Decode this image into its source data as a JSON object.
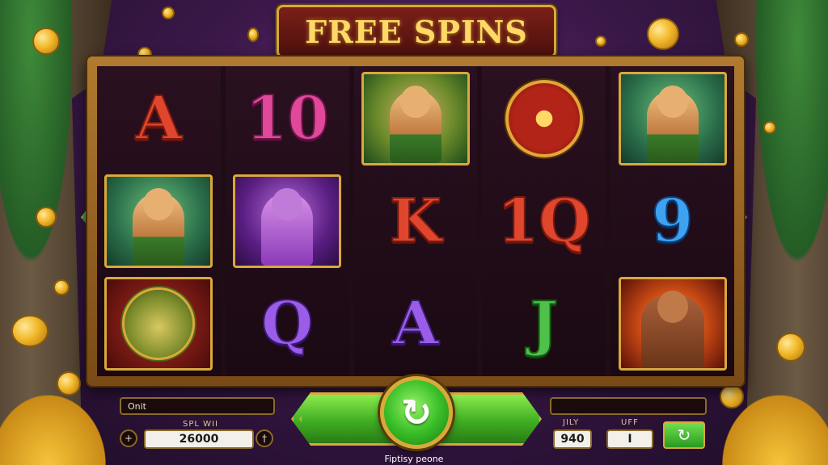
{
  "game": {
    "title": "FREE SPINS"
  },
  "reels": [
    [
      {
        "type": "letter",
        "text": "A",
        "color": "red"
      },
      {
        "type": "card",
        "style": "green",
        "figure": "skin"
      },
      {
        "type": "card",
        "style": "lion",
        "figure": "lion"
      }
    ],
    [
      {
        "type": "letter",
        "text": "10",
        "color": "pink"
      },
      {
        "type": "card",
        "style": "purple",
        "figure": "purple"
      },
      {
        "type": "letter",
        "text": "Q",
        "color": "purple"
      }
    ],
    [
      {
        "type": "card",
        "style": "warriors",
        "figure": "skin"
      },
      {
        "type": "letter",
        "text": "K",
        "color": "red"
      },
      {
        "type": "letter",
        "text": "A",
        "color": "purple"
      }
    ],
    [
      {
        "type": "shield"
      },
      {
        "type": "letter",
        "text": "1Q",
        "color": "red"
      },
      {
        "type": "letter",
        "text": "J",
        "color": "green"
      }
    ],
    [
      {
        "type": "card",
        "style": "green",
        "figure": "skin"
      },
      {
        "type": "letter",
        "text": "9",
        "color": "blue"
      },
      {
        "type": "card",
        "style": "fire",
        "figure": "ape"
      }
    ]
  ],
  "controls": {
    "left_info_text": "Onit",
    "win_label": "SPL WII",
    "win_value": "26000",
    "minus_symbol": "+",
    "plus_symbol": "†",
    "right_info_text": "",
    "bet_label": "JILY",
    "bet_value": "940",
    "lines_label": "UFF",
    "lines_value": "I",
    "spin_icon": "↻",
    "auto_icon": "↻"
  },
  "footer": {
    "text": "Fiptisy peone"
  },
  "colors": {
    "accent_gold": "#d9a93a",
    "spin_green": "#3fae22",
    "title_gold": "#ffd866"
  }
}
